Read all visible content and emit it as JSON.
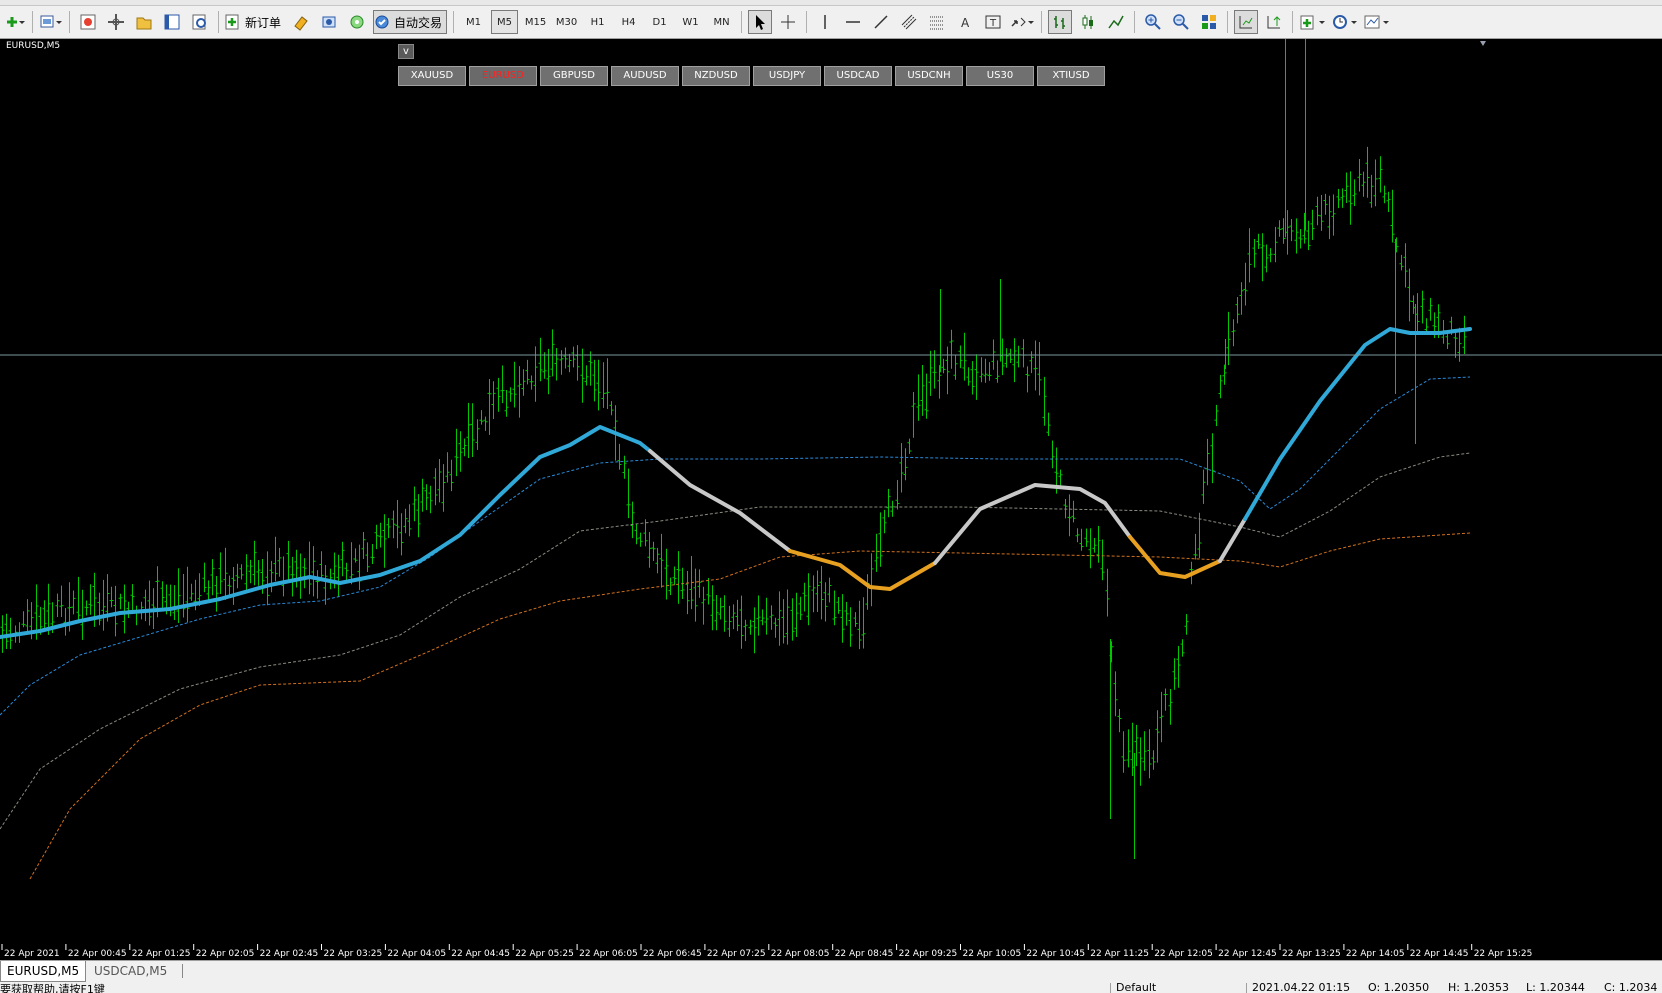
{
  "toolbar": {
    "new_order_label": "新订单",
    "autotrade_label": "自动交易",
    "timeframes": [
      "M1",
      "M5",
      "M15",
      "M30",
      "H1",
      "H4",
      "D1",
      "W1",
      "MN"
    ],
    "active_timeframe": "M5",
    "icons": [
      "new-chart-icon",
      "profiles-icon",
      "market-watch-icon",
      "navigator-icon",
      "data-window-icon",
      "terminal-icon",
      "strategy-tester-icon",
      "new-order-icon",
      "metaeditor-icon",
      "alerts-icon",
      "options-icon",
      "autotrading-icon",
      "cursor-icon",
      "crosshair-icon",
      "vertical-line-icon",
      "horizontal-line-icon",
      "trendline-icon",
      "channel-icon",
      "fibonacci-icon",
      "text-icon",
      "text-label-icon",
      "arrows-icon",
      "bar-chart-icon",
      "candlestick-icon",
      "line-chart-icon",
      "zoom-in-icon",
      "zoom-out-icon",
      "tile-windows-icon",
      "chart-shift-icon",
      "autoscroll-icon",
      "indicators-icon",
      "periods-icon",
      "templates-icon"
    ]
  },
  "chart": {
    "title": "EURUSD,M5",
    "toggle_label": "v",
    "symbols": [
      "XAUUSD",
      "EURUSD",
      "GBPUSD",
      "AUDUSD",
      "NZDUSD",
      "USDJPY",
      "USDCAD",
      "USDCNH",
      "US30",
      "XTIUSD"
    ],
    "active_symbol": "EURUSD",
    "colors": {
      "bars": "#00c800",
      "trend_up": "#30a8d8",
      "trend_down": "#e8a020",
      "trend_neutral": "#c8c8c8",
      "band_blue": "#2a8ad8",
      "band_grey": "#8a8a80",
      "band_orange": "#d07020",
      "price_line": "#7a9aa0"
    }
  },
  "chart_data": {
    "type": "bar",
    "symbol": "EURUSD",
    "timeframe": "M5",
    "x_tick_labels": [
      "22 Apr 2021",
      "22 Apr 00:45",
      "22 Apr 01:25",
      "22 Apr 02:05",
      "22 Apr 02:45",
      "22 Apr 03:25",
      "22 Apr 04:05",
      "22 Apr 04:45",
      "22 Apr 05:25",
      "22 Apr 06:05",
      "22 Apr 06:45",
      "22 Apr 07:25",
      "22 Apr 08:05",
      "22 Apr 08:45",
      "22 Apr 09:25",
      "22 Apr 10:05",
      "22 Apr 10:45",
      "22 Apr 11:25",
      "22 Apr 12:05",
      "22 Apr 12:45",
      "22 Apr 13:25",
      "22 Apr 14:05",
      "22 Apr 14:45",
      "22 Apr 15:25"
    ],
    "grid": false
  },
  "tabs": [
    "EURUSD,M5",
    "USDCAD,M5"
  ],
  "active_tab": "EURUSD,M5",
  "status": {
    "help": "要获取帮助,请按F1键",
    "profile": "Default",
    "datetime": "2021.04.22 01:15",
    "open": "O: 1.20350",
    "high": "H: 1.20353",
    "low": "L: 1.20344",
    "close": "C: 1.2034"
  }
}
